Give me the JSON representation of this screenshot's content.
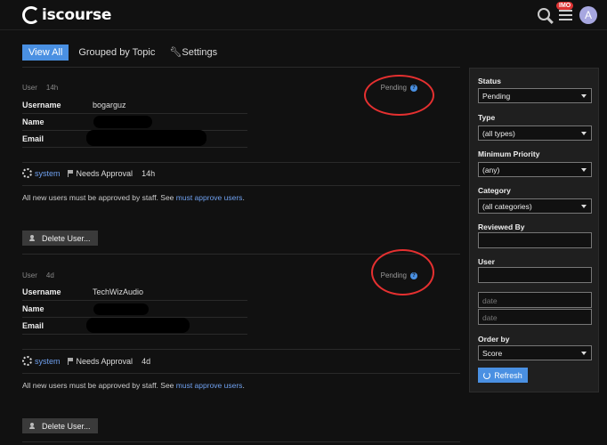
{
  "header": {
    "logo_text": "iscourse",
    "notification_badge": "IMO",
    "avatar_letter": "A"
  },
  "nav": {
    "tabs": [
      {
        "label": "View All"
      },
      {
        "label": "Grouped by Topic"
      },
      {
        "label": "Settings"
      }
    ]
  },
  "reviews": [
    {
      "meta_label": "User",
      "meta_age": "14h",
      "status": "Pending",
      "fields": [
        {
          "key": "Username",
          "value": "bogarguz"
        },
        {
          "key": "Name",
          "value": ""
        },
        {
          "key": "Email",
          "value": ""
        }
      ],
      "approval": {
        "actor": "system",
        "type": "Needs Approval",
        "age": "14h"
      },
      "reason_text": "All new users must be approved by staff. See ",
      "reason_link": "must approve users",
      "reason_end": ".",
      "delete_label": "Delete User..."
    },
    {
      "meta_label": "User",
      "meta_age": "4d",
      "status": "Pending",
      "fields": [
        {
          "key": "Username",
          "value": "TechWizAudio"
        },
        {
          "key": "Name",
          "value": ""
        },
        {
          "key": "Email",
          "value": ""
        }
      ],
      "approval": {
        "actor": "system",
        "type": "Needs Approval",
        "age": "4d"
      },
      "reason_text": "All new users must be approved by staff. See ",
      "reason_link": "must approve users",
      "reason_end": ".",
      "delete_label": "Delete User..."
    }
  ],
  "filters": {
    "status_label": "Status",
    "status_value": "Pending",
    "type_label": "Type",
    "type_value": "(all types)",
    "priority_label": "Minimum Priority",
    "priority_value": "(any)",
    "category_label": "Category",
    "category_value": "(all categories)",
    "reviewed_by_label": "Reviewed By",
    "user_label": "User",
    "date_from_placeholder": "date",
    "date_to_placeholder": "date",
    "order_label": "Order by",
    "order_value": "Score",
    "refresh_label": "Refresh"
  },
  "colors": {
    "accent": "#4a90e2",
    "link": "#6fa0ef",
    "highlight_circle": "#e53030",
    "badge": "#dd3333"
  }
}
